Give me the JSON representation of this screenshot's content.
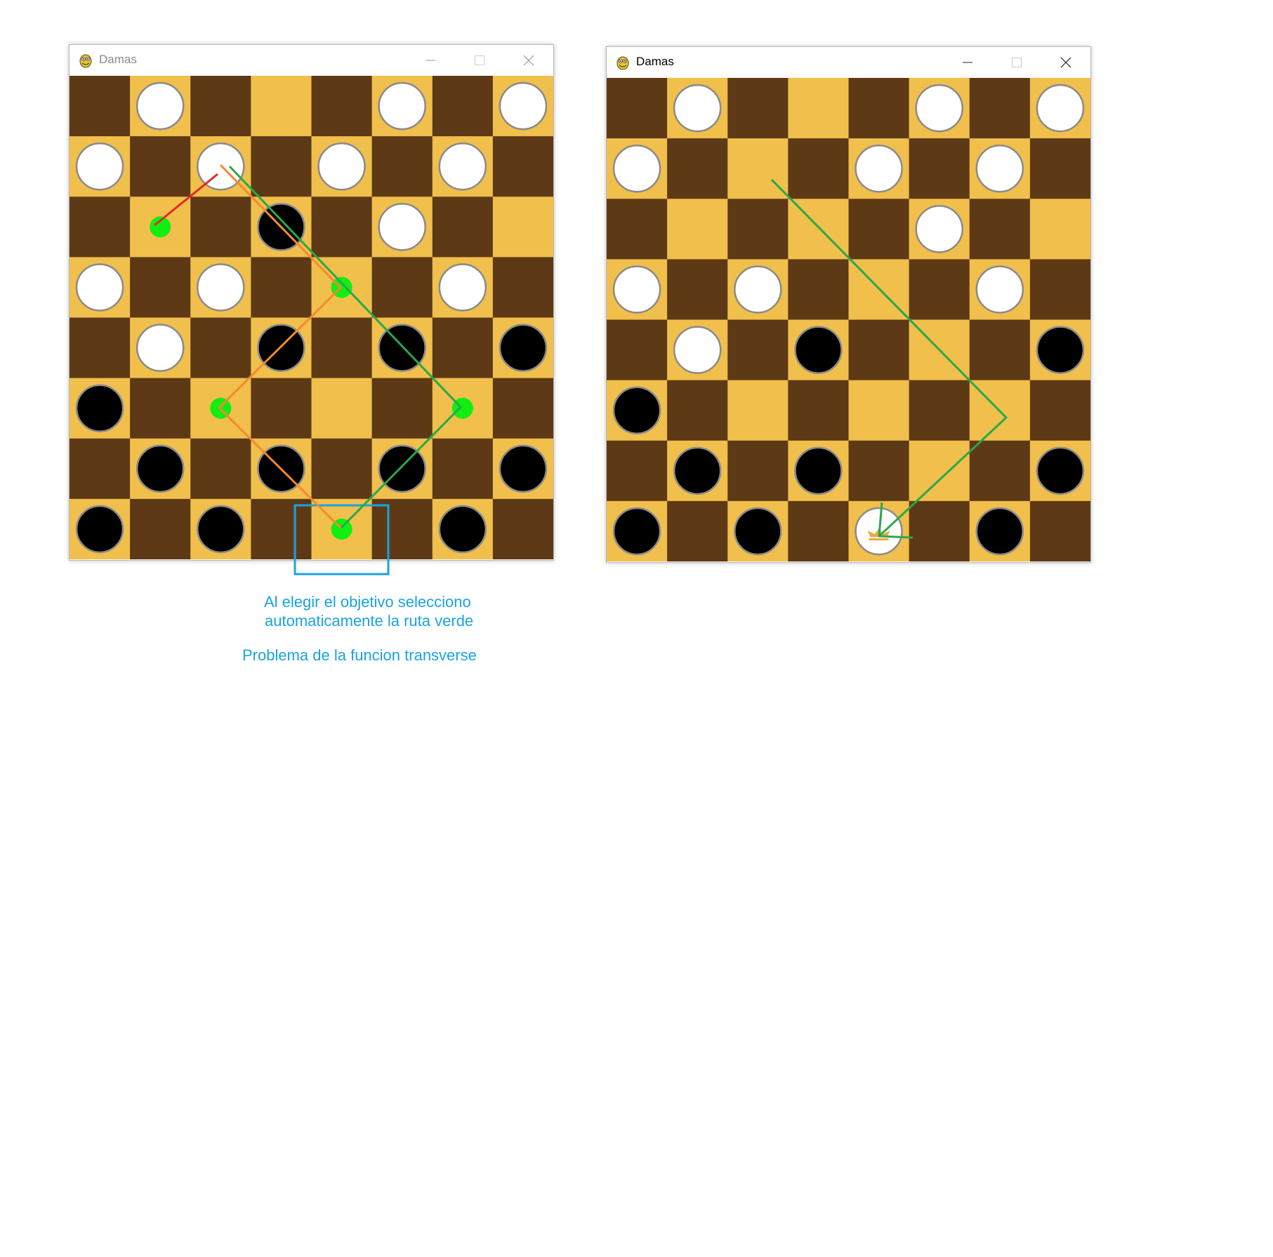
{
  "colors": {
    "dark_square": "#5e3916",
    "light_square": "#f1bf4b",
    "white_piece": "#ffffff",
    "black_piece": "#000000",
    "piece_border": "#8a8a8a",
    "highlight": "#1aa3e0",
    "move_dot": "#11ee11",
    "route_red": "#e12a2a",
    "route_orange": "#f28a2e",
    "route_green": "#2aa84a",
    "crown": "#f0a63a"
  },
  "windows": [
    {
      "title": "Damas",
      "icon": "pygame-snake-icon",
      "controls": [
        "minimize-icon",
        "maximize-icon",
        "close-icon"
      ],
      "board": {
        "size": 8,
        "pieces": [
          {
            "row": 0,
            "col": 1,
            "color": "white"
          },
          {
            "row": 0,
            "col": 5,
            "color": "white"
          },
          {
            "row": 0,
            "col": 7,
            "color": "white"
          },
          {
            "row": 1,
            "col": 0,
            "color": "white"
          },
          {
            "row": 1,
            "col": 2,
            "color": "white"
          },
          {
            "row": 1,
            "col": 4,
            "color": "white"
          },
          {
            "row": 1,
            "col": 6,
            "color": "white"
          },
          {
            "row": 2,
            "col": 3,
            "color": "black"
          },
          {
            "row": 2,
            "col": 5,
            "color": "white"
          },
          {
            "row": 3,
            "col": 0,
            "color": "white"
          },
          {
            "row": 3,
            "col": 2,
            "color": "white"
          },
          {
            "row": 3,
            "col": 6,
            "color": "white"
          },
          {
            "row": 4,
            "col": 1,
            "color": "white"
          },
          {
            "row": 4,
            "col": 3,
            "color": "black"
          },
          {
            "row": 4,
            "col": 5,
            "color": "black"
          },
          {
            "row": 4,
            "col": 7,
            "color": "black"
          },
          {
            "row": 5,
            "col": 0,
            "color": "black"
          },
          {
            "row": 6,
            "col": 1,
            "color": "black"
          },
          {
            "row": 6,
            "col": 3,
            "color": "black"
          },
          {
            "row": 6,
            "col": 5,
            "color": "black"
          },
          {
            "row": 6,
            "col": 7,
            "color": "black"
          },
          {
            "row": 7,
            "col": 0,
            "color": "black"
          },
          {
            "row": 7,
            "col": 2,
            "color": "black"
          },
          {
            "row": 7,
            "col": 6,
            "color": "black"
          }
        ],
        "move_targets": [
          {
            "row": 2,
            "col": 1
          },
          {
            "row": 3,
            "col": 4
          },
          {
            "row": 5,
            "col": 2
          },
          {
            "row": 5,
            "col": 6
          },
          {
            "row": 7,
            "col": 4
          }
        ],
        "target_highlight": {
          "row": 7,
          "col": 4
        }
      }
    },
    {
      "title": "Damas",
      "icon": "pygame-snake-icon",
      "controls": [
        "minimize-icon",
        "maximize-icon",
        "close-icon"
      ],
      "board": {
        "size": 8,
        "pieces": [
          {
            "row": 0,
            "col": 1,
            "color": "white"
          },
          {
            "row": 0,
            "col": 5,
            "color": "white"
          },
          {
            "row": 0,
            "col": 7,
            "color": "white"
          },
          {
            "row": 1,
            "col": 0,
            "color": "white"
          },
          {
            "row": 1,
            "col": 4,
            "color": "white"
          },
          {
            "row": 1,
            "col": 6,
            "color": "white"
          },
          {
            "row": 2,
            "col": 5,
            "color": "white"
          },
          {
            "row": 3,
            "col": 0,
            "color": "white"
          },
          {
            "row": 3,
            "col": 2,
            "color": "white"
          },
          {
            "row": 3,
            "col": 6,
            "color": "white"
          },
          {
            "row": 4,
            "col": 1,
            "color": "white"
          },
          {
            "row": 4,
            "col": 3,
            "color": "black"
          },
          {
            "row": 4,
            "col": 7,
            "color": "black"
          },
          {
            "row": 5,
            "col": 0,
            "color": "black"
          },
          {
            "row": 6,
            "col": 1,
            "color": "black"
          },
          {
            "row": 6,
            "col": 3,
            "color": "black"
          },
          {
            "row": 6,
            "col": 7,
            "color": "black"
          },
          {
            "row": 7,
            "col": 0,
            "color": "black"
          },
          {
            "row": 7,
            "col": 2,
            "color": "black"
          },
          {
            "row": 7,
            "col": 4,
            "color": "white",
            "king": true
          },
          {
            "row": 7,
            "col": 6,
            "color": "black"
          }
        ],
        "move_targets": []
      }
    }
  ],
  "annotations": {
    "line1": "Al elegir el objetivo selecciono",
    "line2": "automaticamente la ruta verde",
    "line3": "Problema de la funcion transverse"
  }
}
